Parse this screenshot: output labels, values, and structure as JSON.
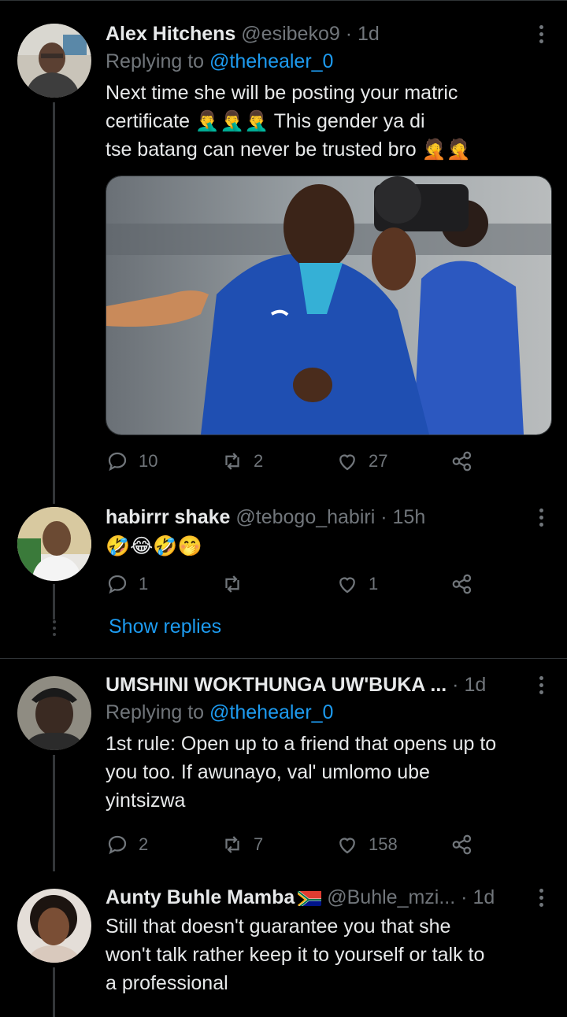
{
  "tweets": [
    {
      "name": "Alex Hitchens",
      "handle": "@esibeko9",
      "time": "1d",
      "replying_prefix": "Replying to",
      "replying_to": "@thehealer_0",
      "text_line1": "Next time she will be posting your matric",
      "text_line2": "certificate 🤦‍♂️🤦‍♂️🤦‍♂️ This gender ya di",
      "text_line3": "tse batang can never be trusted bro 🤦🤦",
      "replies": "10",
      "retweets": "2",
      "likes": "27"
    },
    {
      "name": "habirrr shake",
      "handle": "@tebogo_habiri",
      "time": "15h",
      "emojis": "🤣😂🤣🤭",
      "replies": "1",
      "retweets": "",
      "likes": "1",
      "show_replies": "Show replies"
    },
    {
      "name": "UMSHINI WOKTHUNGA UW'BUKA ...",
      "time": "1d",
      "replying_prefix": "Replying to",
      "replying_to": "@thehealer_0",
      "text_line1": "1st rule: Open up to a friend that opens up to",
      "text_line2": "you too. If awunayo, val' umlomo ube",
      "text_line3": "yintsizwa",
      "replies": "2",
      "retweets": "7",
      "likes": "158"
    },
    {
      "name": "Aunty Buhle Mamba",
      "handle": "@Buhle_mzi...",
      "time": "1d",
      "text_line1": "Still that doesn't guarantee you that she",
      "text_line2": "won't talk rather keep it to yourself or talk to",
      "text_line3": "a professional"
    }
  ],
  "icons": {
    "reply": "reply-icon",
    "retweet": "retweet-icon",
    "like": "heart-icon",
    "share": "share-icon",
    "more": "more-vertical-icon"
  },
  "colors": {
    "background": "#000000",
    "text": "#e7e9ea",
    "muted": "#71767b",
    "link": "#1d9bf0"
  }
}
